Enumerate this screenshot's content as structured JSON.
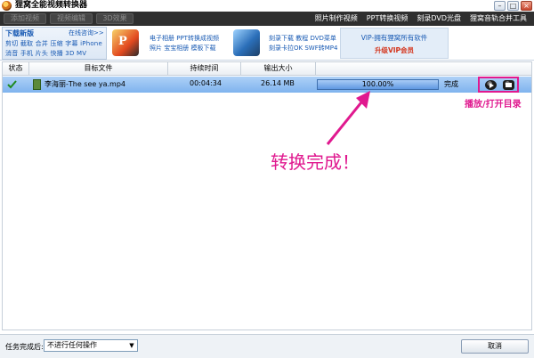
{
  "window": {
    "title": "狸窝全能视频转换器",
    "controls": {
      "minimize": "–",
      "maximize": "□",
      "close": "×"
    }
  },
  "menu": {
    "tabs": [
      "添加视频",
      "视频编辑",
      "3D效果"
    ],
    "links": [
      "照片制作视频",
      "PPT转换视频",
      "刻录DVD光盘",
      "狸窝音轨合并工具"
    ]
  },
  "ads": {
    "download": {
      "title": "下载新版",
      "online_link": "在线咨询>>",
      "row1": "剪切 截取 合并 压缩 字幕 iPhone",
      "row2": "消音 手机 片头 快播 3D MV"
    },
    "promo1": {
      "line1": "电子相册 PPT转换成视频",
      "line2": "照片 宝宝相册 模板下载"
    },
    "promo2": {
      "line1": "刻录下载 教程 DVD菜单",
      "line2": "刻录卡拉OK SWF转MP4"
    },
    "vip": {
      "line1": "VIP-拥有狸窝所有软件",
      "line2": "升级VIP会员"
    }
  },
  "table": {
    "headers": {
      "status": "状态",
      "target": "目标文件",
      "duration": "持续时间",
      "size": "输出大小"
    },
    "rows": [
      {
        "file_name": "李海丽-The see ya.mp4",
        "duration": "00:04:34",
        "output_size": "26.14 MB",
        "progress_percent": 100,
        "progress_text": "100.00%",
        "status": "完成"
      }
    ]
  },
  "annotations": {
    "play_open": "播放/打开目录",
    "done": "转换完成！",
    "color": "#e0198f"
  },
  "bottom": {
    "after_label": "任务完成后:",
    "after_value": "不进行任何操作",
    "cancel": "取消"
  }
}
